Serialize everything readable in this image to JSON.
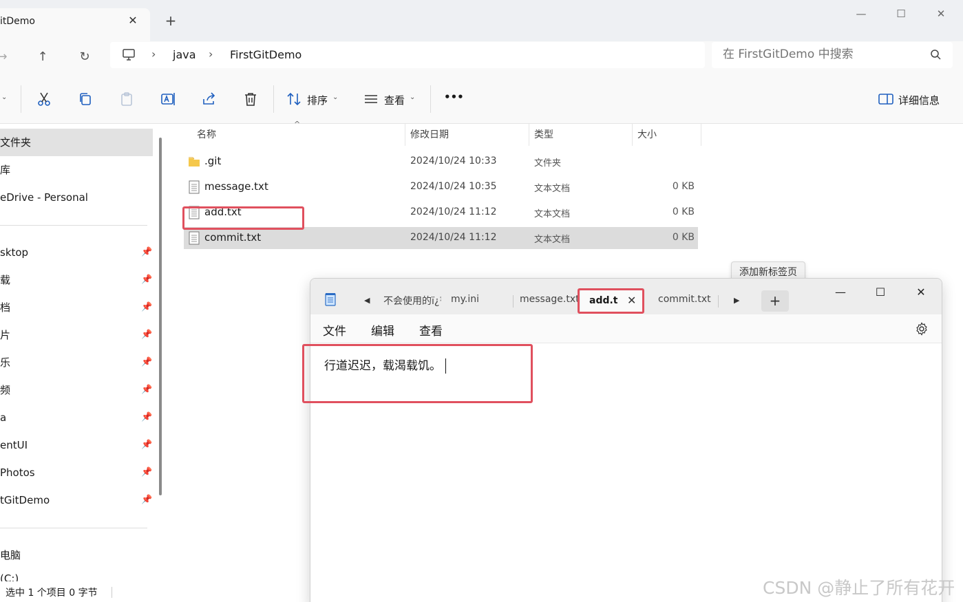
{
  "explorer": {
    "tab_title": "itDemo",
    "tab_close": "✕",
    "new_tab": "+",
    "window_controls": {
      "minimize": "—",
      "maximize": "☐",
      "close": "✕"
    },
    "nav": {
      "forward": "→",
      "up": "↑",
      "refresh": "↻"
    },
    "breadcrumb": [
      "java",
      "FirstGitDemo"
    ],
    "search_placeholder": "在 FirstGitDemo 中搜索",
    "toolbar": {
      "sort_label": "排序",
      "view_label": "查看",
      "more_label": "•••",
      "details_label": "详细信息",
      "icons": [
        "cut-icon",
        "copy-icon",
        "paste-icon",
        "rename-icon",
        "share-icon",
        "delete-icon"
      ]
    },
    "sidebar": {
      "items": [
        {
          "label": "文件夹",
          "selected": true
        },
        {
          "label": "库"
        },
        {
          "label": "eDrive - Personal"
        },
        {
          "label": "sktop",
          "pinned": true
        },
        {
          "label": "载",
          "pinned": true
        },
        {
          "label": "档",
          "pinned": true
        },
        {
          "label": "片",
          "pinned": true
        },
        {
          "label": "乐",
          "pinned": true
        },
        {
          "label": "频",
          "pinned": true
        },
        {
          "label": "a",
          "pinned": true
        },
        {
          "label": "entUI",
          "pinned": true
        },
        {
          "label": "Photos",
          "pinned": true
        },
        {
          "label": "tGitDemo",
          "pinned": true
        },
        {
          "label": "电脑"
        },
        {
          "label": "(C:)"
        }
      ],
      "pin_glyph": "📌"
    },
    "columns": {
      "name": "名称",
      "date": "修改日期",
      "type": "类型",
      "size": "大小"
    },
    "files": [
      {
        "name": ".git",
        "date": "2024/10/24 10:33",
        "type": "文件夹",
        "size": "",
        "kind": "folder"
      },
      {
        "name": "message.txt",
        "date": "2024/10/24 10:35",
        "type": "文本文档",
        "size": "0 KB",
        "kind": "text"
      },
      {
        "name": "add.txt",
        "date": "2024/10/24 11:12",
        "type": "文本文档",
        "size": "0 KB",
        "kind": "text"
      },
      {
        "name": "commit.txt",
        "date": "2024/10/24 11:12",
        "type": "文本文档",
        "size": "0 KB",
        "kind": "text",
        "selected": true
      }
    ],
    "status": "选中 1 个项目  0 字节"
  },
  "notepad": {
    "tabs": [
      "不会使用的ï¿½",
      "my.ini",
      "message.txt",
      "commit.txt"
    ],
    "active_tab": "add.txt",
    "active_tab_close": "✕",
    "scroll_left": "◀",
    "scroll_right": "▶",
    "add_tab": "+",
    "tooltip": "添加新标签页",
    "window_controls": {
      "minimize": "—",
      "maximize": "☐",
      "close": "✕"
    },
    "menu": [
      "文件",
      "编辑",
      "查看"
    ],
    "content": "行道迟迟，载渴载饥。"
  },
  "watermark": "CSDN @静止了所有花开",
  "colors": {
    "highlight_box": "#e0505e",
    "accent": "#1f5fbf"
  }
}
